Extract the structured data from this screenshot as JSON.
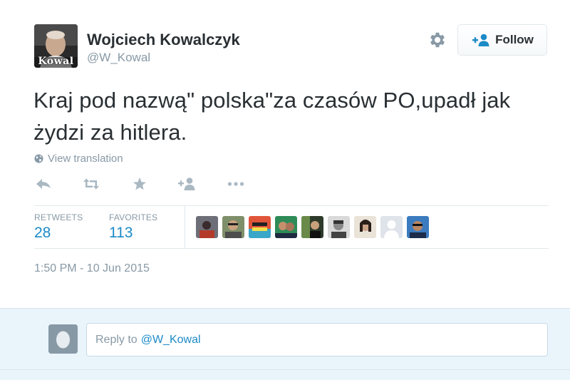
{
  "author": {
    "fullname": "Wojciech Kowalczyk",
    "username": "@W_Kowal",
    "avatar_label": "Kowal"
  },
  "header": {
    "follow_label": "Follow",
    "settings_icon": "gear-icon",
    "follow_icon": "add-user-icon"
  },
  "tweet": {
    "text": "Kraj pod nazwą\" polska\"za czasów PO,upadł jak żydzi za hitlera.",
    "translate_label": "View translation",
    "timestamp": "1:50 PM - 10 Jun 2015"
  },
  "actions": [
    {
      "name": "reply-icon"
    },
    {
      "name": "retweet-icon"
    },
    {
      "name": "favorite-icon"
    },
    {
      "name": "follow-user-icon"
    },
    {
      "name": "more-icon"
    }
  ],
  "stats": {
    "retweets_label": "RETWEETS",
    "retweets_count": "28",
    "favorites_label": "FAVORITES",
    "favorites_count": "113"
  },
  "reply": {
    "prefix": "Reply to",
    "mention": "@W_Kowal"
  },
  "colors": {
    "link": "#1b8ac7",
    "muted": "#8899a6",
    "text": "#292f33",
    "reply_bg": "#eaf4fb"
  }
}
